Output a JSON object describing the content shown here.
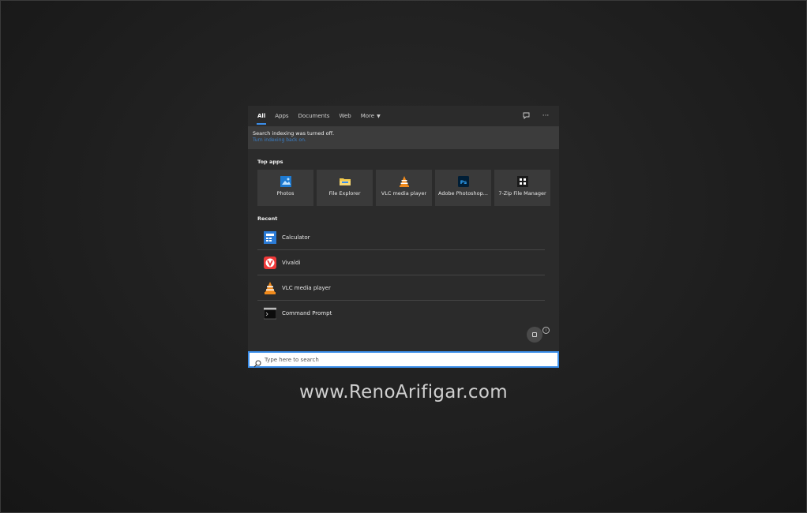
{
  "tabs": [
    {
      "label": "All",
      "active": true
    },
    {
      "label": "Apps"
    },
    {
      "label": "Documents"
    },
    {
      "label": "Web"
    },
    {
      "label": "More",
      "dropdown": true
    }
  ],
  "top_icons": [
    "feedback-icon",
    "more-options-icon"
  ],
  "banner": {
    "title": "Search indexing was turned off.",
    "link": "Turn indexing back on."
  },
  "top_apps": {
    "label": "Top apps",
    "items": [
      {
        "label": "Photos",
        "icon": "photos-icon"
      },
      {
        "label": "File Explorer",
        "icon": "file-explorer-icon"
      },
      {
        "label": "VLC media player",
        "icon": "vlc-icon"
      },
      {
        "label": "Adobe Photoshop...",
        "icon": "photoshop-icon"
      },
      {
        "label": "7-Zip File Manager",
        "icon": "7zip-icon"
      }
    ]
  },
  "recent": {
    "label": "Recent",
    "items": [
      {
        "label": "Calculator",
        "icon": "calculator-icon"
      },
      {
        "label": "Vivaldi",
        "icon": "vivaldi-icon"
      },
      {
        "label": "VLC media player",
        "icon": "vlc-icon"
      },
      {
        "label": "Command Prompt",
        "icon": "command-prompt-icon"
      }
    ]
  },
  "search": {
    "placeholder": "Type here to search"
  },
  "watermark": "www.RenoArifigar.com",
  "colors": {
    "accent": "#3b8eea",
    "panel": "#2b2b2b",
    "tile": "#3a3a3a"
  }
}
